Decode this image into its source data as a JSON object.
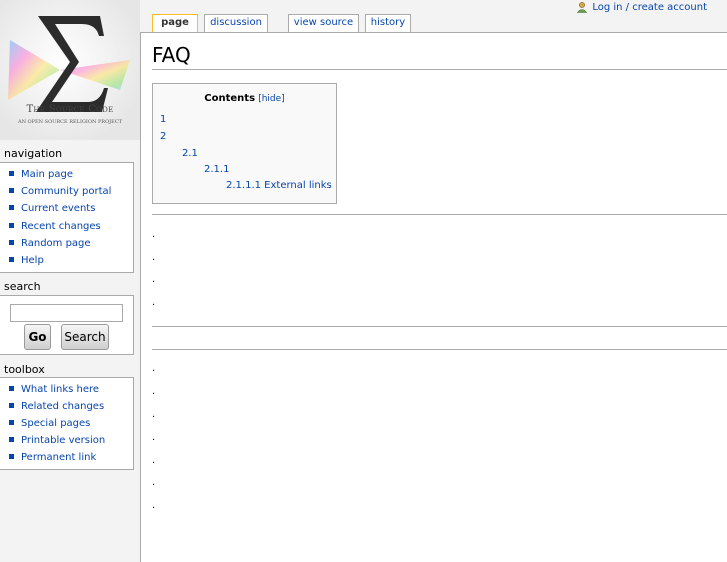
{
  "personal": {
    "login_label": "Log in / create account"
  },
  "logo": {
    "title": "The Source Code",
    "tagline": "AN OPEN SOURCE RELIGION PROJECT"
  },
  "tabs": [
    {
      "label": "page"
    },
    {
      "label": "discussion"
    },
    {
      "label": "view source"
    },
    {
      "label": "history"
    }
  ],
  "page": {
    "title": "FAQ"
  },
  "toc": {
    "title": "Contents",
    "hide_label": "[hide]",
    "items": [
      "1",
      "2",
      "2.1",
      "2.1.1",
      "2.1.1.1 External links"
    ]
  },
  "content": {
    "dots": [
      ".",
      ".",
      ".",
      ".",
      ".",
      ".",
      ".",
      ".",
      ".",
      ".",
      "."
    ]
  },
  "navigation": {
    "title": "navigation",
    "items": [
      "Main page",
      "Community portal",
      "Current events",
      "Recent changes",
      "Random page",
      "Help"
    ]
  },
  "search": {
    "title": "search",
    "value": "",
    "go_label": "Go",
    "search_label": "Search"
  },
  "toolbox": {
    "title": "toolbox",
    "items": [
      "What links here",
      "Related changes",
      "Special pages",
      "Printable version",
      "Permanent link"
    ]
  }
}
